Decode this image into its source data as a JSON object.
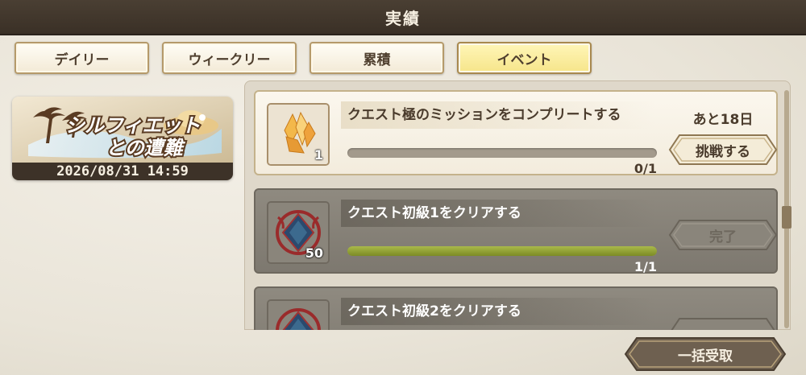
{
  "header": {
    "title": "実績"
  },
  "tabs": [
    {
      "label": "デイリー",
      "active": false
    },
    {
      "label": "ウィークリー",
      "active": false
    },
    {
      "label": "累積",
      "active": false
    },
    {
      "label": "イベント",
      "active": true
    }
  ],
  "event_banner": {
    "logo_text": "シルフィエットとの遭難",
    "end_date": "2026/08/31 14:59"
  },
  "missions": [
    {
      "title": "クエスト極のミッションをコンプリートする",
      "reward_icon": "crystal-icon",
      "reward_count": "1",
      "progress_text": "0/1",
      "progress": 0,
      "remaining": "あと18日",
      "button_label": "挑戦する",
      "completed": false
    },
    {
      "title": "クエスト初級1をクリアする",
      "reward_icon": "emblem-icon",
      "reward_count": "50",
      "progress_text": "1/1",
      "progress": 1,
      "button_label": "完了",
      "completed": true
    },
    {
      "title": "クエスト初級2をクリアする",
      "reward_icon": "emblem-icon",
      "completed": true
    }
  ],
  "footer": {
    "receive_all_label": "一括受取"
  },
  "colors": {
    "tab_active": "#f6e58a",
    "progress_fill": "#8c9b2e",
    "header_bg": "#3f352b"
  }
}
